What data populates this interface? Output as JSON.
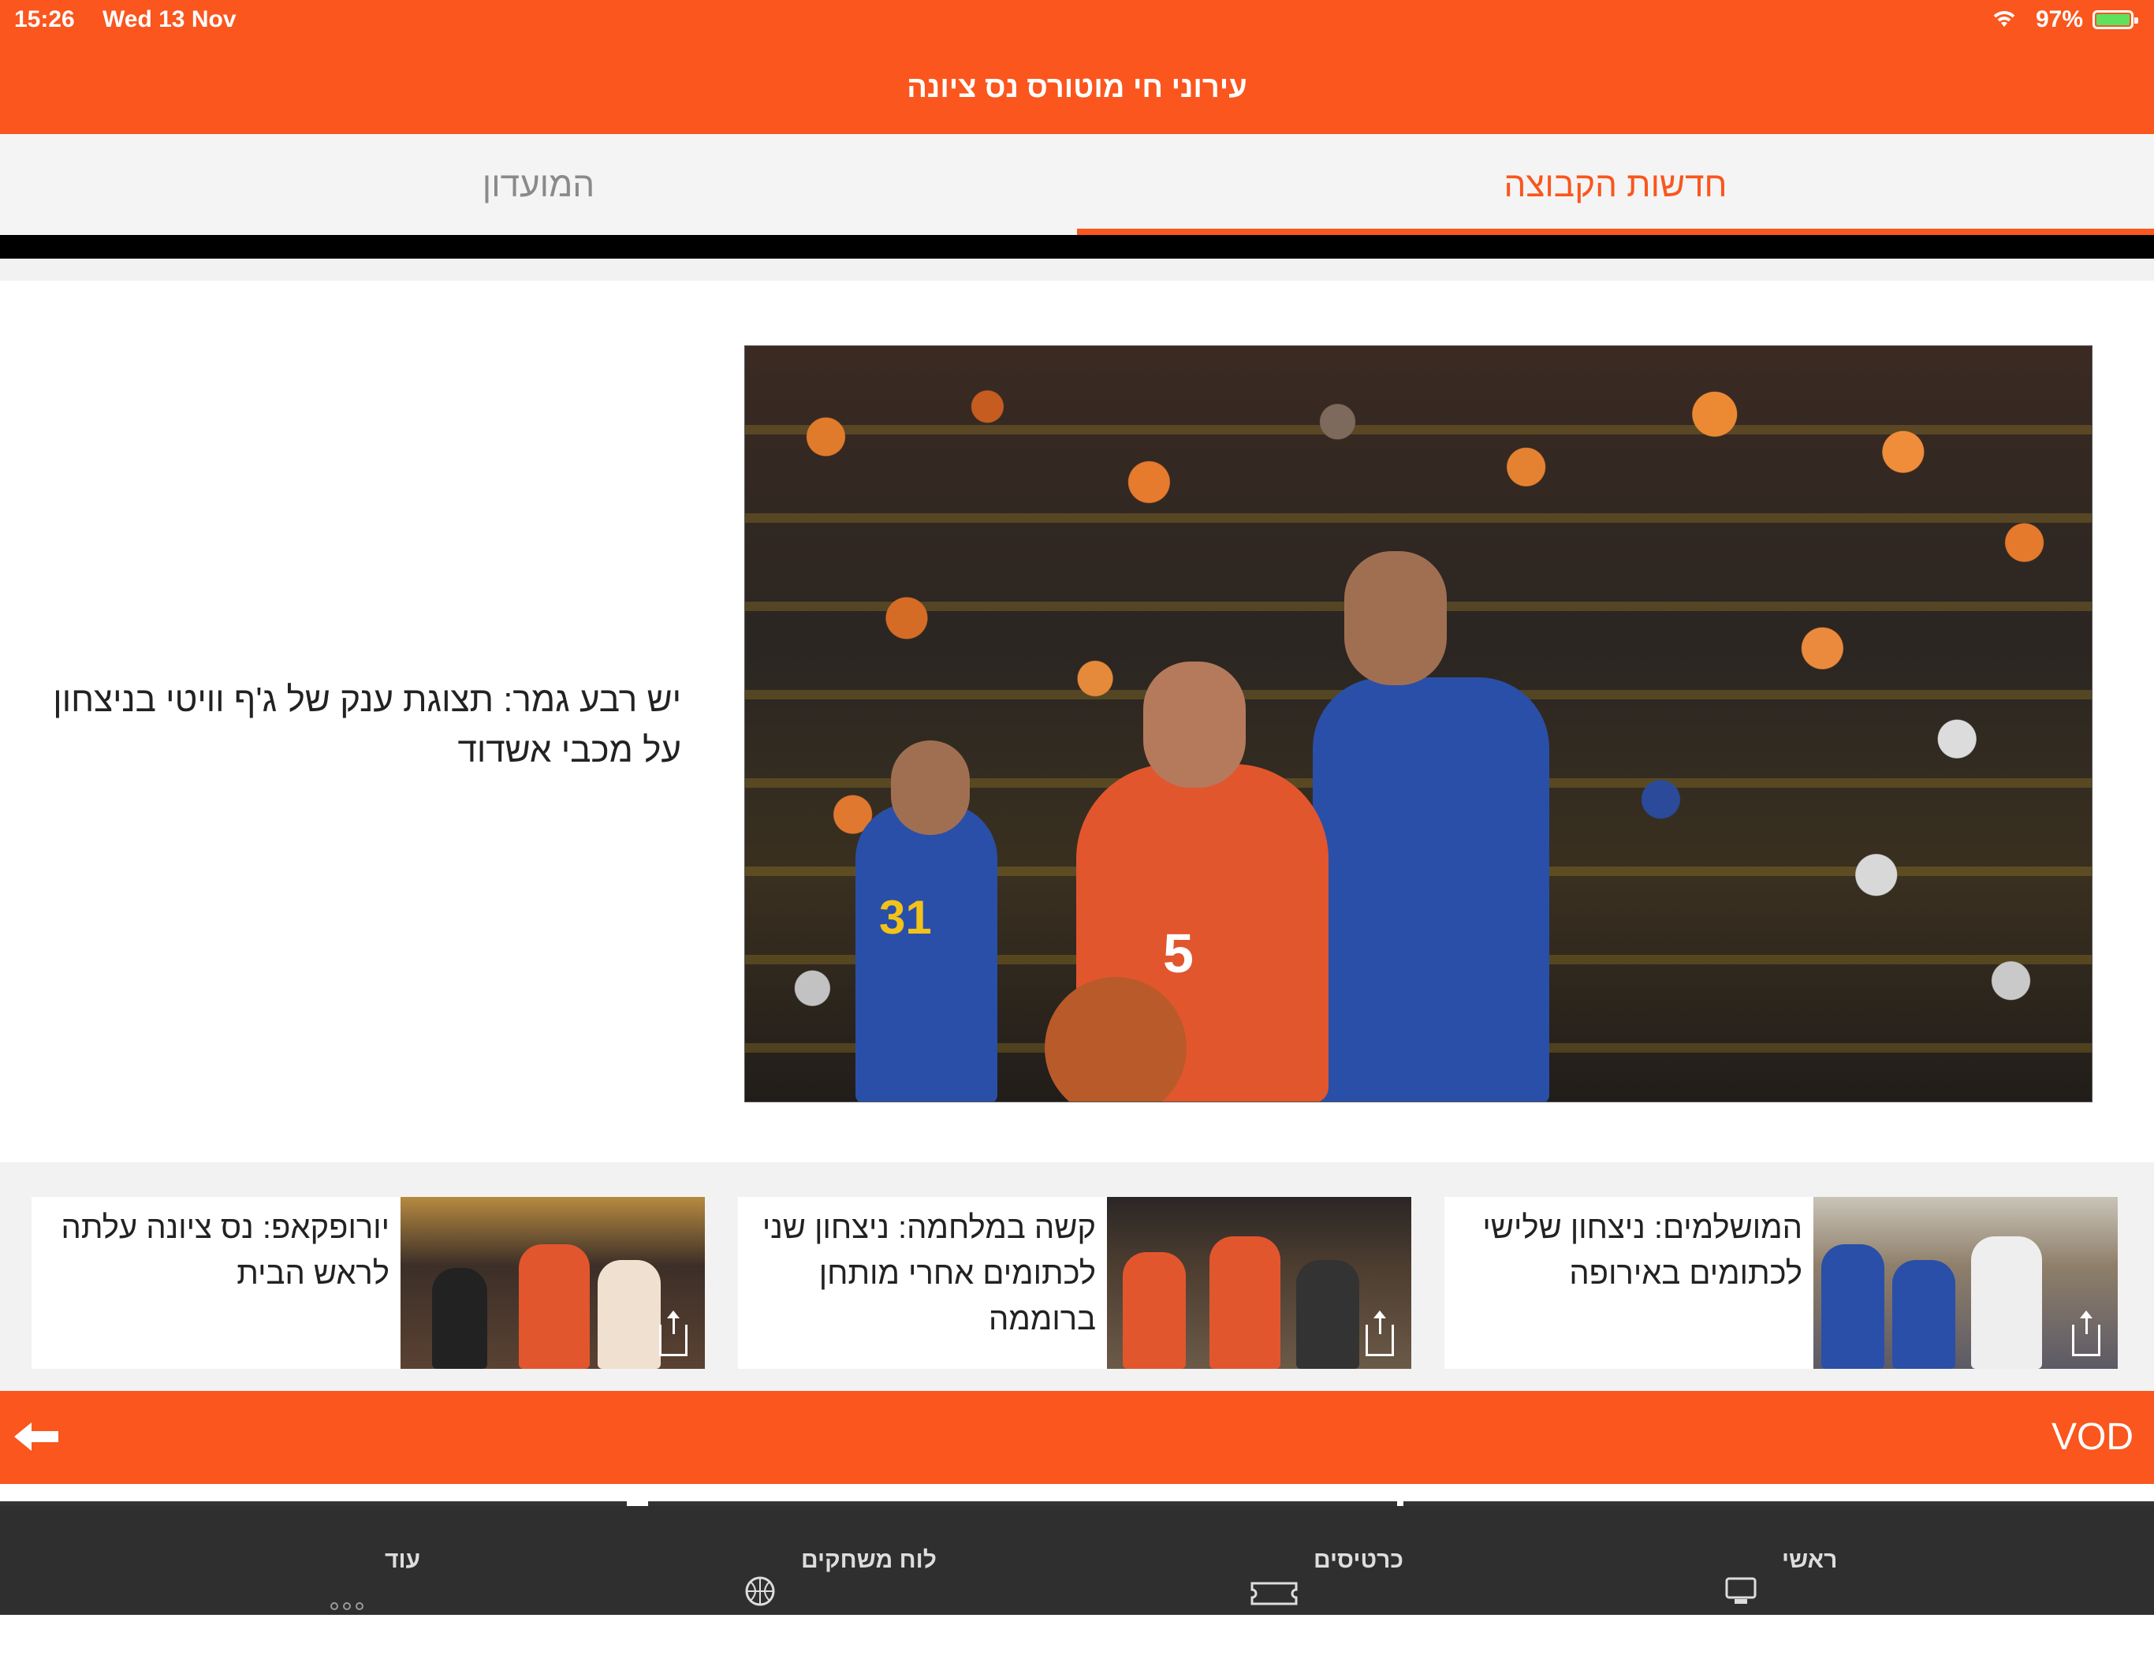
{
  "status": {
    "time": "15:26",
    "date": "Wed 13 Nov",
    "battery": "97%"
  },
  "header": {
    "title": "עירוני חי מוטורס נס ציונה"
  },
  "tabs": [
    {
      "label": "חדשות הקבוצה",
      "active": true
    },
    {
      "label": "המועדון",
      "active": false
    }
  ],
  "hero": {
    "headline": "יש רבע גמר: תצוגת ענק של ג'ף וויטי בניצחון על מכבי אשדוד",
    "image_jersey_orange": "5",
    "image_jersey_blue": "31"
  },
  "cards": [
    {
      "title": "המושלמים: ניצחון שלישי לכתומים באירופה"
    },
    {
      "title": "קשה במלחמה: ניצחון שני לכתומים אחרי מותחן ברוממה"
    },
    {
      "title": "יורופקאפ: נס ציונה עלתה לראש הבית"
    }
  ],
  "vod": {
    "title": "VOD"
  },
  "tabbar": [
    {
      "label": "ראשי",
      "icon": "home-screen-icon"
    },
    {
      "label": "כרטיסים",
      "icon": "ticket-icon"
    },
    {
      "label": "לוח משחקים",
      "icon": "basketball-icon"
    },
    {
      "label": "עוד",
      "icon": "more-dots-icon"
    }
  ],
  "colors": {
    "brand": "#fa561e",
    "tabbar": "#2f2f2f"
  }
}
